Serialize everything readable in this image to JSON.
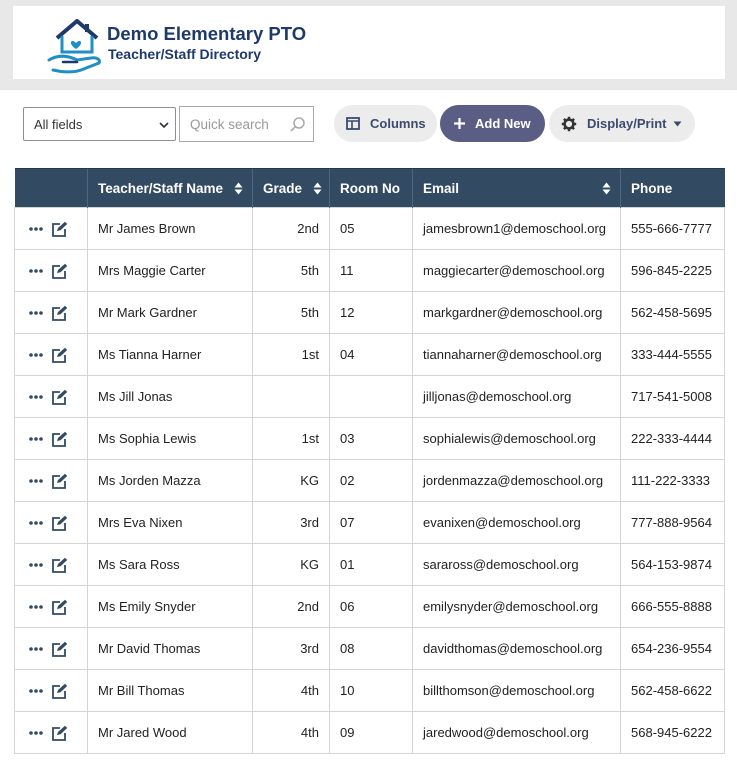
{
  "header": {
    "title": "Demo Elementary PTO",
    "subtitle": "Teacher/Staff Directory"
  },
  "toolbar": {
    "field_select_value": "All fields",
    "search_placeholder": "Quick search",
    "columns_label": "Columns",
    "add_new_label": "Add New",
    "display_print_label": "Display/Print"
  },
  "colors": {
    "header_blue": "#1e3a6a",
    "table_header": "#334a63",
    "add_button": "#5a5e85"
  },
  "table": {
    "columns": [
      "",
      "Teacher/Staff Name",
      "Grade",
      "Room No",
      "Email",
      "Phone"
    ],
    "rows": [
      {
        "name": "Mr James Brown",
        "grade": "2nd",
        "room": "05",
        "email": "jamesbrown1@demoschool.org",
        "phone": "555-666-7777"
      },
      {
        "name": "Mrs Maggie Carter",
        "grade": "5th",
        "room": "11",
        "email": "maggiecarter@demoschool.org",
        "phone": "596-845-2225"
      },
      {
        "name": "Mr Mark Gardner",
        "grade": "5th",
        "room": "12",
        "email": "markgardner@demoschool.org",
        "phone": "562-458-5695"
      },
      {
        "name": "Ms Tianna Harner",
        "grade": "1st",
        "room": "04",
        "email": "tiannaharner@demoschool.org",
        "phone": "333-444-5555"
      },
      {
        "name": "Ms Jill Jonas",
        "grade": "",
        "room": "",
        "email": "jilljonas@demoschool.org",
        "phone": "717-541-5008"
      },
      {
        "name": "Ms Sophia Lewis",
        "grade": "1st",
        "room": "03",
        "email": "sophialewis@demoschool.org",
        "phone": "222-333-4444"
      },
      {
        "name": "Ms Jorden Mazza",
        "grade": "KG",
        "room": "02",
        "email": "jordenmazza@demoschool.org",
        "phone": "111-222-3333"
      },
      {
        "name": "Mrs Eva Nixen",
        "grade": "3rd",
        "room": "07",
        "email": "evanixen@demoschool.org",
        "phone": "777-888-9564"
      },
      {
        "name": "Ms Sara Ross",
        "grade": "KG",
        "room": "01",
        "email": "saraross@demoschool.org",
        "phone": "564-153-9874"
      },
      {
        "name": "Ms Emily Snyder",
        "grade": "2nd",
        "room": "06",
        "email": "emilysnyder@demoschool.org",
        "phone": "666-555-8888"
      },
      {
        "name": "Mr David Thomas",
        "grade": "3rd",
        "room": "08",
        "email": "davidthomas@demoschool.org",
        "phone": "654-236-9554"
      },
      {
        "name": "Mr Bill Thomas",
        "grade": "4th",
        "room": "10",
        "email": "billthomson@demoschool.org",
        "phone": "562-458-6622"
      },
      {
        "name": "Mr Jared Wood",
        "grade": "4th",
        "room": "09",
        "email": "jaredwood@demoschool.org",
        "phone": "568-945-6222"
      }
    ]
  }
}
